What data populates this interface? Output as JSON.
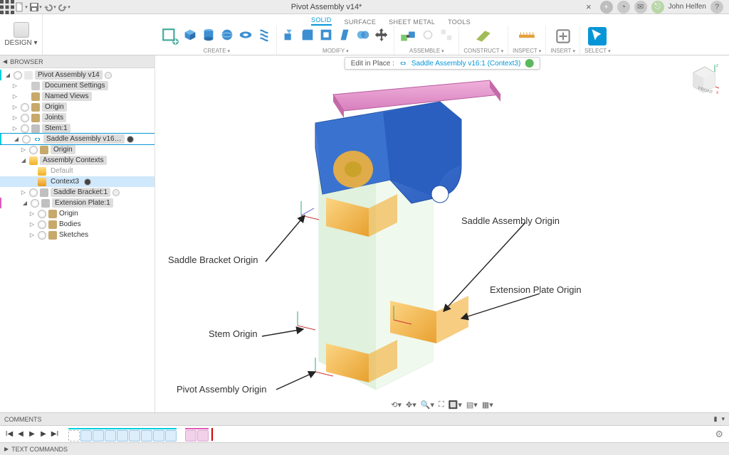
{
  "appbar": {
    "title": "Pivot Assembly v14*",
    "user": "John Helfen"
  },
  "ribbon": {
    "design_label": "DESIGN ▾",
    "tabs": [
      "SOLID",
      "SURFACE",
      "SHEET METAL",
      "TOOLS"
    ],
    "active_tab": 0,
    "groups": [
      "CREATE",
      "MODIFY",
      "ASSEMBLE",
      "CONSTRUCT",
      "INSPECT",
      "INSERT",
      "SELECT"
    ]
  },
  "browser": {
    "header": "BROWSER",
    "nodes": {
      "root": "Pivot Assembly v14",
      "doc_settings": "Document Settings",
      "named_views": "Named Views",
      "origin": "Origin",
      "joints": "Joints",
      "stem": "Stem:1",
      "saddle_asm": "Saddle Assembly v16…",
      "saddle_origin": "Origin",
      "asm_ctx": "Assembly Contexts",
      "default": "Default",
      "context3": "Context3",
      "saddle_bracket": "Saddle Bracket:1",
      "ext_plate": "Extension Plate:1",
      "ext_origin": "Origin",
      "bodies": "Bodies",
      "sketches": "Sketches"
    }
  },
  "editbar": {
    "label": "Edit in Place :",
    "link": "Saddle Assembly v16:1 (Context3)"
  },
  "annotations": {
    "saddle_bracket_origin": "Saddle Bracket Origin",
    "stem_origin": "Stem Origin",
    "pivot_asm_origin": "Pivot Assembly Origin",
    "saddle_asm_origin": "Saddle Assembly Origin",
    "ext_plate_origin": "Extension Plate Origin"
  },
  "viewcube": {
    "front": "FRONT"
  },
  "comments": {
    "label": "COMMENTS"
  },
  "textcmd": {
    "label": "TEXT COMMANDS"
  },
  "colors": {
    "accent": "#0696d7",
    "bracket_blue": "#2b5fbf",
    "plate_pink": "#e490c4",
    "origin_orange": "#f3b13a",
    "stem_green": "#c6e8c0"
  }
}
